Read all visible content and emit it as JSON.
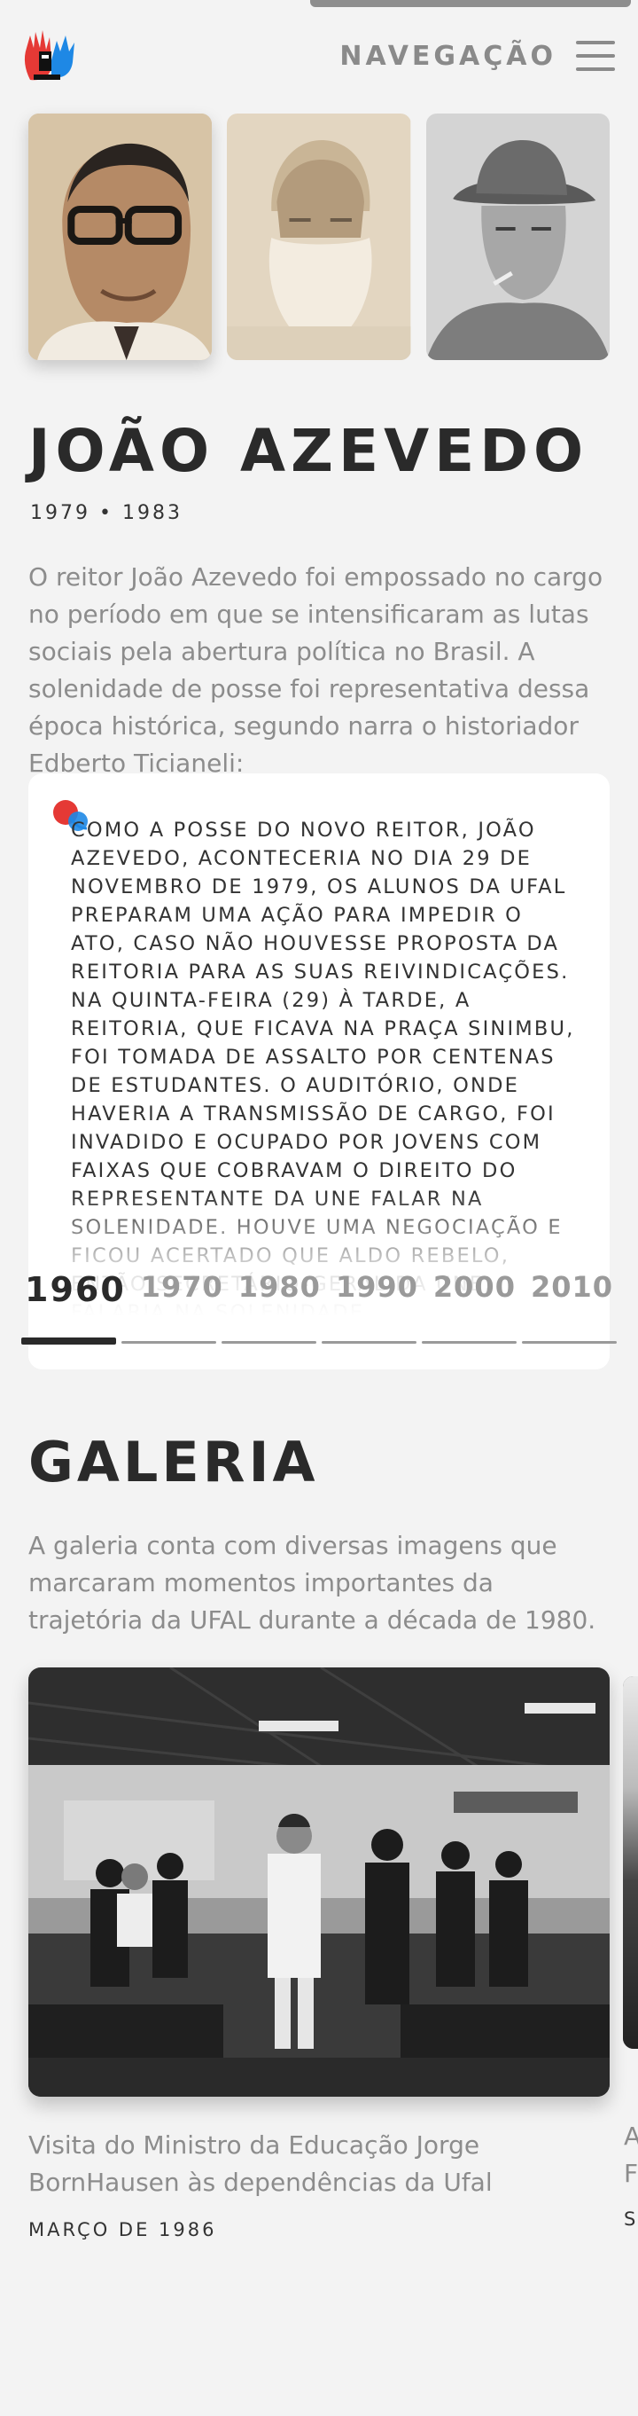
{
  "header": {
    "nav_label": "NAVEGAÇÃO",
    "menu_icon": "hamburger-menu-icon",
    "logo_icon": "hand-logo-icon",
    "logo_colors": [
      "#e53935",
      "#1e88e5",
      "#111111"
    ]
  },
  "portraits": [
    {
      "name": "portrait-joao-azevedo",
      "active": true
    },
    {
      "name": "portrait-bearded-man",
      "active": false
    },
    {
      "name": "portrait-man-with-hat",
      "active": false
    }
  ],
  "person": {
    "name": "JOÃO AZEVEDO",
    "years": "1979  •  1983",
    "intro": "O reitor João Azevedo foi empossado no cargo no período em que se intensificaram as lutas sociais pela abertura política no Brasil. A solenidade de posse foi representativa dessa época histórica, segundo narra o historiador Edberto Ticianeli:"
  },
  "quote": {
    "icon": "quote-mark-icon",
    "text": "Como a posse do novo reitor, João Azevedo, aconteceria no dia 29 de novembro de 1979, os alunos da Ufal preparam uma ação para impedir o ato, caso não houvesse proposta da reitoria para as suas reivindicações. Na quinta-feira (29) à tarde, a reitoria, que ficava na Praça Sinimbu, foi tomada de assalto por centenas de estudantes. O auditório, onde haveria a transmissão de cargo, foi invadido e ocupado por jovens com faixas que cobravam o direito do representante da UNE falar na solenidade. Houve uma negociação e ficou acertado que Aldo Rebelo, então secretário-geral da UNE, falaria na solenidade."
  },
  "decades": {
    "items": [
      "1960",
      "1970",
      "1980",
      "1990",
      "2000",
      "2010"
    ],
    "active_index": 0
  },
  "gallery": {
    "title": "GALERIA",
    "intro": "A galeria conta com diversas imagens que marcaram momentos importantes da trajetória da UFAL durante a década de 1980.",
    "items": [
      {
        "caption": "Visita do Ministro da Educação Jorge BornHausen às dependências da Ufal",
        "date": "MARÇO DE 1986"
      }
    ],
    "next_peek": [
      "A",
      "F",
      "S"
    ]
  },
  "colors": {
    "background": "#f3f3f3",
    "text_dark": "#2a2a2a",
    "text_muted": "#8c8c8c",
    "accent_red": "#e53935",
    "accent_blue": "#1e88e5"
  }
}
